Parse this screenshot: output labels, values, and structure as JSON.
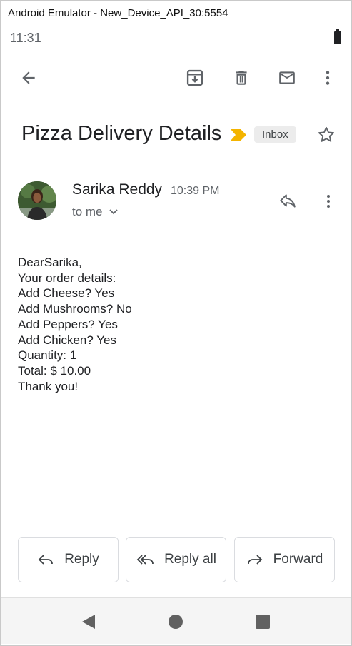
{
  "window": {
    "title": "Android Emulator - New_Device_API_30:5554"
  },
  "status_bar": {
    "time": "11:31",
    "battery_icon": "battery-full-icon"
  },
  "toolbar": {
    "back_icon": "arrow-back-icon",
    "archive_icon": "archive-icon",
    "delete_icon": "trash-icon",
    "mark_unread_icon": "mail-icon",
    "more_icon": "more-vert-icon"
  },
  "email": {
    "subject": "Pizza Delivery Details",
    "label": "Inbox",
    "sender": "Sarika Reddy",
    "time": "10:39 PM",
    "recipients": "to me",
    "body_lines": [
      "DearSarika,",
      "Your order details:",
      "Add Cheese? Yes",
      "Add Mushrooms? No",
      "Add Peppers? Yes",
      "Add Chicken? Yes",
      "Quantity: 1",
      "Total: $ 10.00",
      "Thank you!"
    ]
  },
  "actions": {
    "reply": "Reply",
    "reply_all": "Reply all",
    "forward": "Forward"
  },
  "colors": {
    "importance": "#f4b400",
    "chip_bg": "#ececec",
    "icon": "#5f6368"
  }
}
